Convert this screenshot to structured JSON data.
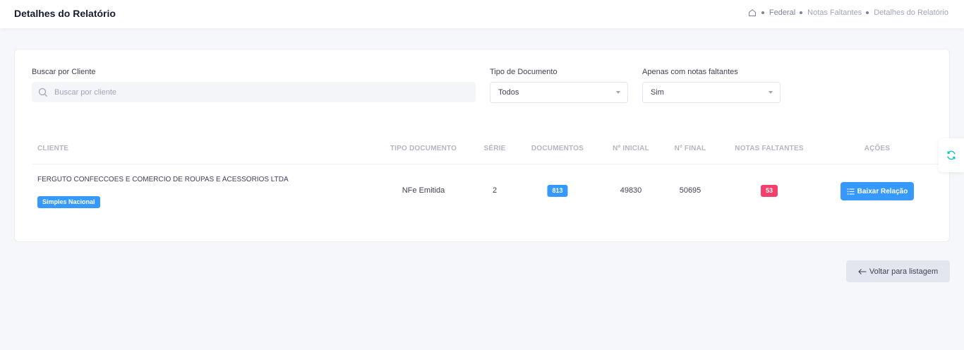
{
  "header": {
    "title": "Detalhes do Relatório",
    "breadcrumb": [
      "Federal",
      "Notas Faltantes",
      "Detalhes do Relatório"
    ]
  },
  "filters": {
    "search_label": "Buscar por Cliente",
    "search_placeholder": "Buscar por cliente",
    "search_value": "",
    "doc_type_label": "Tipo de Documento",
    "doc_type_value": "Todos",
    "missing_only_label": "Apenas com notas faltantes",
    "missing_only_value": "Sim"
  },
  "table": {
    "columns": {
      "cliente": "CLIENTE",
      "tipo_documento": "TIPO DOCUMENTO",
      "serie": "SÉRIE",
      "documentos": "DOCUMENTOS",
      "inicial": "Nº INICIAL",
      "final": "Nº FINAL",
      "faltantes": "NOTAS FALTANTES",
      "acoes": "AÇÕES"
    },
    "rows": [
      {
        "cliente": "FERGUTO CONFECCOES E COMERCIO DE ROUPAS E ACESSORIOS LTDA",
        "regime": "Simples Nacional",
        "tipo_documento": "NFe Emitida",
        "serie": "2",
        "documentos": "813",
        "inicial": "49830",
        "final": "50695",
        "faltantes": "53",
        "acao": "Baixar Relação"
      }
    ]
  },
  "footer": {
    "back_label": "Voltar para listagem"
  },
  "icons": {
    "home": "home-icon",
    "search": "search-icon",
    "list": "list-icon",
    "refresh": "refresh-icon",
    "back": "arrow-left-icon"
  },
  "colors": {
    "primary": "#3699ff",
    "danger": "#f1416c",
    "refresh_accent": "#1bc5bd"
  }
}
